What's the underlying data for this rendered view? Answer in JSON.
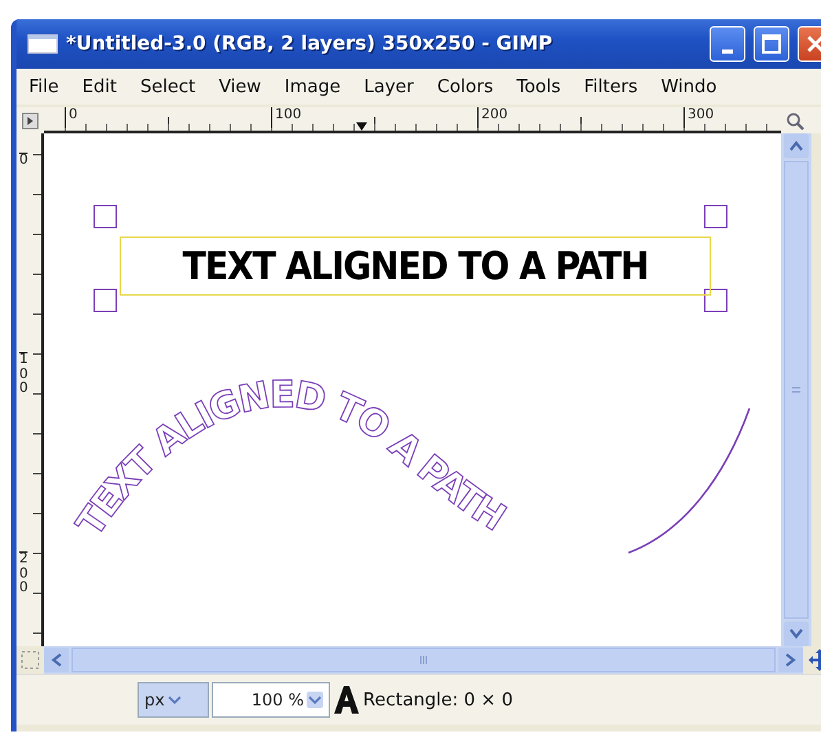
{
  "window": {
    "title": "*Untitled-3.0 (RGB, 2 layers) 350x250 - GIMP"
  },
  "menu": [
    "File",
    "Edit",
    "Select",
    "View",
    "Image",
    "Layer",
    "Colors",
    "Tools",
    "Filters",
    "Windo"
  ],
  "rulers": {
    "horizontal": [
      "0",
      "100",
      "200",
      "300"
    ],
    "vertical": [
      "0",
      "100",
      "200"
    ]
  },
  "canvas": {
    "text_layer": "TEXT ALIGNED TO A PATH",
    "path_text": "TEXT ALIGNED TO A PATH"
  },
  "status_bar": {
    "unit": "px",
    "zoom": "100 %",
    "message": "Rectangle: 0 × 0"
  }
}
